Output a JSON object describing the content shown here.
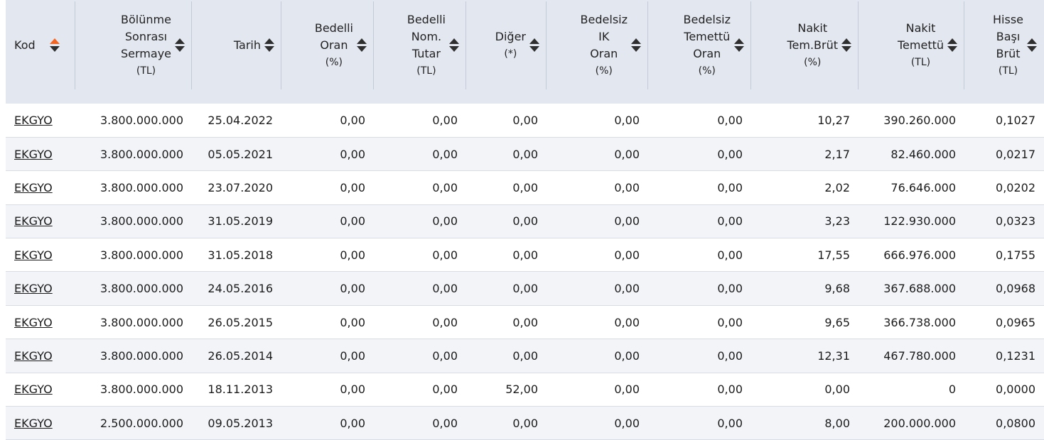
{
  "columns": [
    {
      "lines": [
        "Kod"
      ],
      "small_lines": [],
      "sort": "active"
    },
    {
      "lines": [
        "Bölünme",
        "Sonrası",
        "Sermaye"
      ],
      "small_lines": [
        "(TL)"
      ],
      "sort": "none"
    },
    {
      "lines": [
        "Tarih"
      ],
      "small_lines": [],
      "sort": "none"
    },
    {
      "lines": [
        "Bedelli",
        "Oran"
      ],
      "small_lines": [
        "(%)"
      ],
      "sort": "none"
    },
    {
      "lines": [
        "Bedelli",
        "Nom.",
        "Tutar"
      ],
      "small_lines": [
        "(TL)"
      ],
      "sort": "none"
    },
    {
      "lines": [
        "Diğer"
      ],
      "small_lines": [
        "(*)"
      ],
      "sort": "none"
    },
    {
      "lines": [
        "Bedelsiz",
        "IK",
        "Oran"
      ],
      "small_lines": [
        "(%)"
      ],
      "sort": "none"
    },
    {
      "lines": [
        "Bedelsiz",
        "Temettü",
        "Oran"
      ],
      "small_lines": [
        "(%)"
      ],
      "sort": "none"
    },
    {
      "lines": [
        "Nakit",
        "Tem.Brüt"
      ],
      "small_lines": [
        "(%)"
      ],
      "sort": "none"
    },
    {
      "lines": [
        "Nakit",
        "Temettü"
      ],
      "small_lines": [
        "(TL)"
      ],
      "sort": "none"
    },
    {
      "lines": [
        "Hisse",
        "Başı",
        "Brüt"
      ],
      "small_lines": [
        "(TL)"
      ],
      "sort": "none"
    }
  ],
  "rows": [
    [
      "EKGYO",
      "3.800.000.000",
      "25.04.2022",
      "0,00",
      "0,00",
      "0,00",
      "0,00",
      "0,00",
      "10,27",
      "390.260.000",
      "0,1027"
    ],
    [
      "EKGYO",
      "3.800.000.000",
      "05.05.2021",
      "0,00",
      "0,00",
      "0,00",
      "0,00",
      "0,00",
      "2,17",
      "82.460.000",
      "0,0217"
    ],
    [
      "EKGYO",
      "3.800.000.000",
      "23.07.2020",
      "0,00",
      "0,00",
      "0,00",
      "0,00",
      "0,00",
      "2,02",
      "76.646.000",
      "0,0202"
    ],
    [
      "EKGYO",
      "3.800.000.000",
      "31.05.2019",
      "0,00",
      "0,00",
      "0,00",
      "0,00",
      "0,00",
      "3,23",
      "122.930.000",
      "0,0323"
    ],
    [
      "EKGYO",
      "3.800.000.000",
      "31.05.2018",
      "0,00",
      "0,00",
      "0,00",
      "0,00",
      "0,00",
      "17,55",
      "666.976.000",
      "0,1755"
    ],
    [
      "EKGYO",
      "3.800.000.000",
      "24.05.2016",
      "0,00",
      "0,00",
      "0,00",
      "0,00",
      "0,00",
      "9,68",
      "367.688.000",
      "0,0968"
    ],
    [
      "EKGYO",
      "3.800.000.000",
      "26.05.2015",
      "0,00",
      "0,00",
      "0,00",
      "0,00",
      "0,00",
      "9,65",
      "366.738.000",
      "0,0965"
    ],
    [
      "EKGYO",
      "3.800.000.000",
      "26.05.2014",
      "0,00",
      "0,00",
      "0,00",
      "0,00",
      "0,00",
      "12,31",
      "467.780.000",
      "0,1231"
    ],
    [
      "EKGYO",
      "3.800.000.000",
      "18.11.2013",
      "0,00",
      "0,00",
      "52,00",
      "0,00",
      "0,00",
      "0,00",
      "0",
      "0,0000"
    ],
    [
      "EKGYO",
      "2.500.000.000",
      "09.05.2013",
      "0,00",
      "0,00",
      "0,00",
      "0,00",
      "0,00",
      "8,00",
      "200.000.000",
      "0,0800"
    ]
  ],
  "colors": {
    "header_bg": "#e3e7f0",
    "sort_active": "#f26522",
    "row_alt_bg": "#f2f4f8",
    "text": "#1b1b1b"
  }
}
